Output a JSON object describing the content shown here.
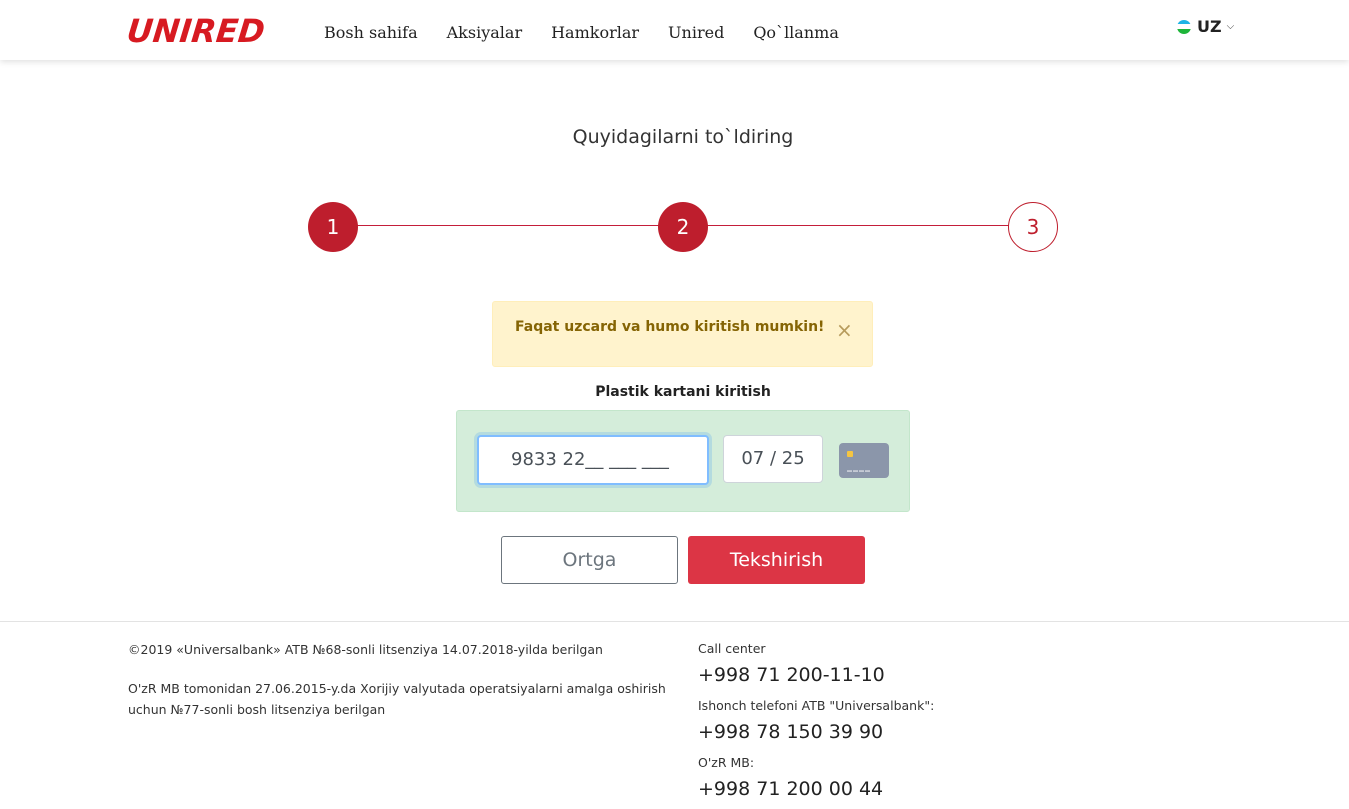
{
  "header": {
    "logo": "UNIRED",
    "nav": [
      "Bosh sahifa",
      "Aksiyalar",
      "Hamkorlar",
      "Unired",
      "Qo`llanma"
    ],
    "language": "UZ"
  },
  "page": {
    "title": "Quyidagilarni to`ldiring"
  },
  "stepper": {
    "steps": [
      "1",
      "2",
      "3"
    ],
    "current_step": 2
  },
  "alert": {
    "text": "Faqat uzcard va humo kiritish mumkin!",
    "close": "×"
  },
  "card_form": {
    "label": "Plastik kartani kiritish",
    "card_number_value": "9833 22__ ___ ___",
    "expiry_value": "07 / 25",
    "card_icon_dashes": "____"
  },
  "buttons": {
    "back": "Ortga",
    "check": "Tekshirish"
  },
  "footer": {
    "copyright": "©2019 «Universalbank» ATB №68-sonli litsenziya 14.07.2018-yilda berilgan",
    "license": "O'zR MB tomonidan 27.06.2015-y.da Xorijiy valyutada operatsiyalarni amalga oshirish uchun №77-sonli bosh litsenziya berilgan",
    "contacts": [
      {
        "label": "Call center",
        "phone": "+998 71 200-11-10"
      },
      {
        "label": "Ishonch telefoni ATB \"Universalbank\":",
        "phone": "+998 78 150 39 90"
      },
      {
        "label": "O'zR MB:",
        "phone": "+998 71 200 00 44"
      }
    ]
  },
  "colors": {
    "brand_red": "#d71a21",
    "step_red": "#be1e2d",
    "alert_bg": "#fff3cd",
    "card_box_bg": "#d4edda",
    "check_button": "#dc3545"
  }
}
